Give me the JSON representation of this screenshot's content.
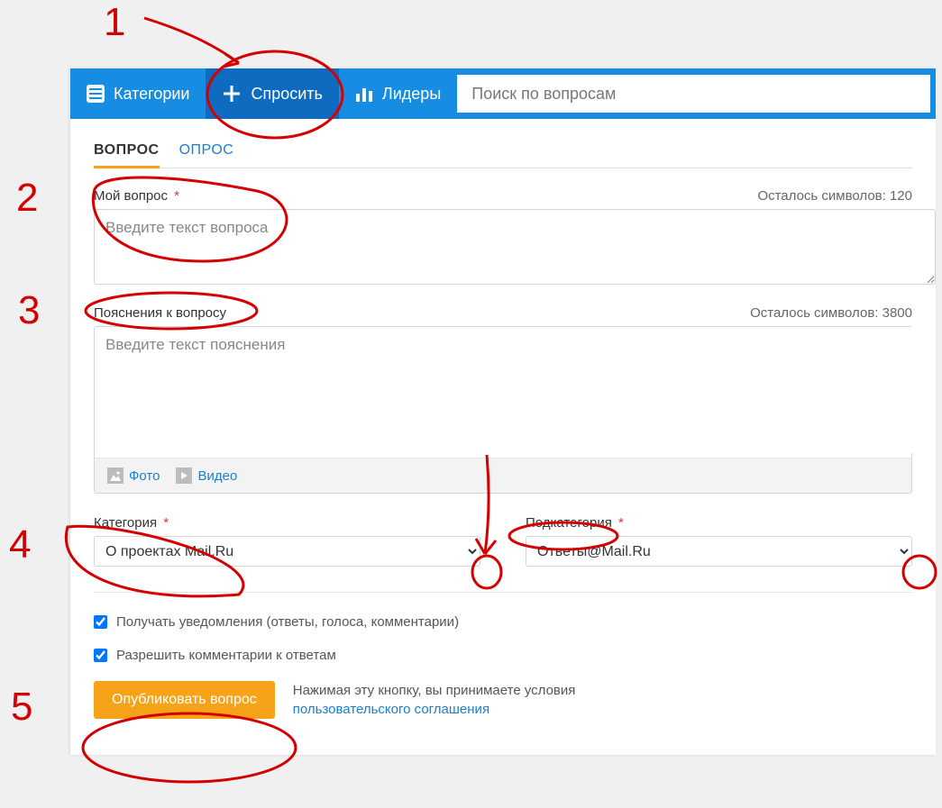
{
  "nav": {
    "categories": "Категории",
    "ask": "Спросить",
    "leaders": "Лидеры",
    "search_placeholder": "Поиск по вопросам"
  },
  "tabs": {
    "question": "ВОПРОС",
    "poll": "ОПРОС"
  },
  "question_field": {
    "label": "Мой вопрос",
    "counter": "Осталось символов: 120",
    "placeholder": "Введите текст вопроса"
  },
  "explain_field": {
    "label": "Пояснения к вопросу",
    "counter": "Осталось символов: 3800",
    "placeholder": "Введите текст пояснения",
    "photo": "Фото",
    "video": "Видео"
  },
  "category": {
    "label": "Категория",
    "selected": "О проектах Mail.Ru"
  },
  "subcategory": {
    "label": "Подкатегория",
    "selected": "Ответы@Mail.Ru"
  },
  "options": {
    "notifications": "Получать уведомления (ответы, голоса, комментарии)",
    "allow_comments": "Разрешить комментарии к ответам"
  },
  "submit": {
    "button": "Опубликовать вопрос",
    "disclaimer_text": "Нажимая эту кнопку, вы принимаете условия ",
    "disclaimer_link": "пользовательского соглашения"
  },
  "anno": {
    "n1": "1",
    "n2": "2",
    "n3": "3",
    "n4": "4",
    "n5": "5"
  }
}
